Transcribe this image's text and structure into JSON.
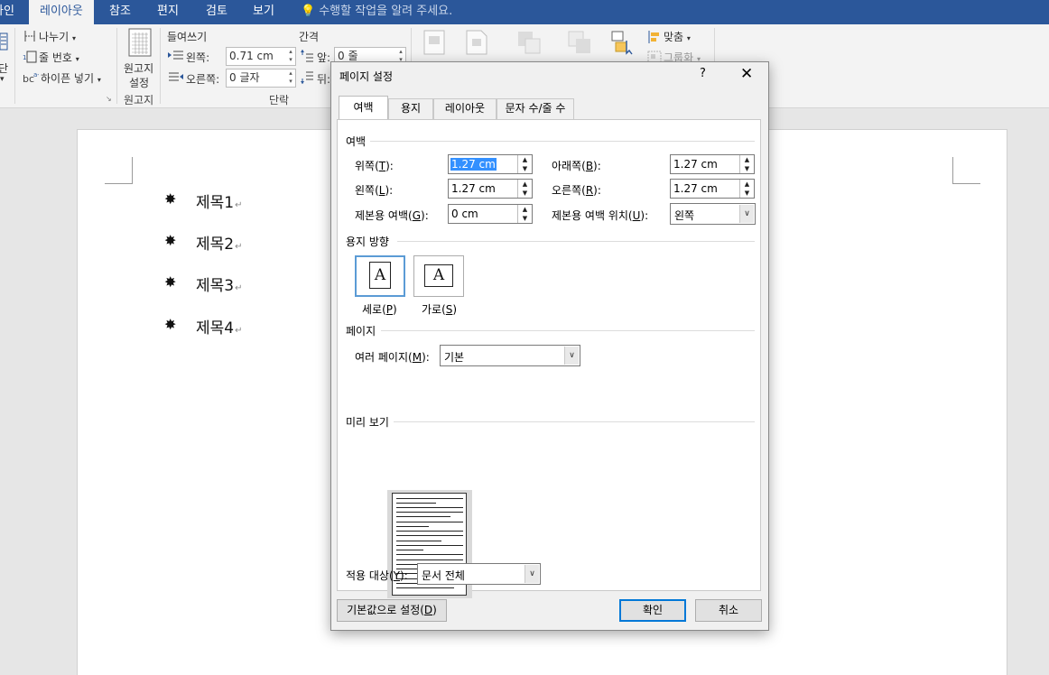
{
  "ribbon_tabs": [
    {
      "label": "파인"
    },
    {
      "label": "레이아웃"
    },
    {
      "label": "참조"
    },
    {
      "label": "편지"
    },
    {
      "label": "검토"
    },
    {
      "label": "보기"
    }
  ],
  "tell_me": "수행할 작업을 알려 주세요.",
  "ribbon": {
    "partial_left_1": "단",
    "breaks": "나누기",
    "line_numbers": "줄 번호",
    "hyphenation": "하이픈 넣기",
    "manuscript_label_1": "원고지",
    "manuscript_label_2": "설정",
    "manuscript_group": "원고지",
    "indent_title": "들여쓰기",
    "indent_left_label": "왼쪽:",
    "indent_left_value": "0.71 cm",
    "indent_right_label": "오른쪽:",
    "indent_right_value": "0 글자",
    "spacing_title": "간격",
    "spacing_before_label": "앞:",
    "spacing_before_value": "0 줄",
    "spacing_after_label": "뒤:",
    "paragraph_group": "단락",
    "align": "맞춤",
    "group": "그룹화"
  },
  "document": {
    "headings": [
      "제목1",
      "제목2",
      "제목3",
      "제목4"
    ],
    "bullet_symbol": "✸",
    "paragraph_mark": "↵"
  },
  "dialog": {
    "title": "페이지 설정",
    "help": "?",
    "close": "✕",
    "tabs": [
      {
        "label": "여백",
        "active": true
      },
      {
        "label": "용지",
        "active": false
      },
      {
        "label": "레이아웃",
        "active": false
      },
      {
        "label": "문자 수/줄 수",
        "active": false
      }
    ],
    "margins_section": "여백",
    "top_label": "위쪽(",
    "top_key": "T",
    "top_value": "1.27 cm",
    "bottom_label": "아래쪽(",
    "bottom_key": "B",
    "bottom_value": "1.27 cm",
    "left_label": "왼쪽(",
    "left_key": "L",
    "left_value": "1.27 cm",
    "right_label": "오른쪽(",
    "right_key": "R",
    "right_value": "1.27 cm",
    "gutter_label": "제본용 여백(",
    "gutter_key": "G",
    "gutter_value": "0 cm",
    "gutter_pos_label": "제본용 여백 위치(",
    "gutter_pos_key": "U",
    "gutter_pos_value": "왼쪽",
    "orientation_section": "용지 방향",
    "portrait_label": "세로(",
    "portrait_key": "P",
    "landscape_label": "가로(",
    "landscape_key": "S",
    "orientation_glyph": "A",
    "pages_section": "페이지",
    "multiple_pages_label": "여러 페이지(",
    "multiple_pages_key": "M",
    "multiple_pages_value": "기본",
    "preview_section": "미리 보기",
    "apply_to_label": "적용 대상(",
    "apply_to_key": "Y",
    "apply_to_value": "문서 전체",
    "set_default": "기본값으로 설정(",
    "set_default_key": "D",
    "ok": "확인",
    "cancel": "취소"
  }
}
